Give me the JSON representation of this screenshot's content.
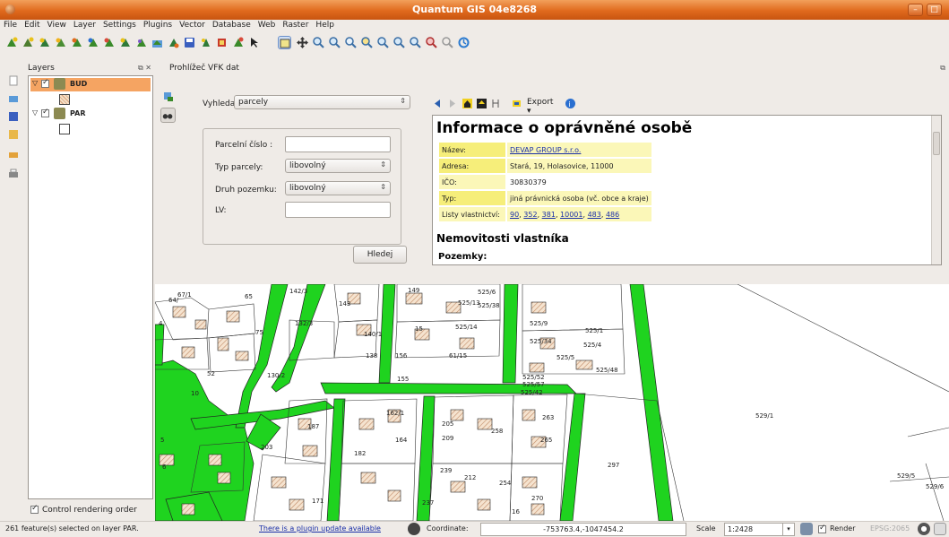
{
  "window": {
    "title": "Quantum GIS 04e8268"
  },
  "menu": [
    "File",
    "Edit",
    "View",
    "Layer",
    "Settings",
    "Plugins",
    "Vector",
    "Database",
    "Web",
    "Raster",
    "Help"
  ],
  "layers_panel": {
    "title": "Layers",
    "layers": [
      {
        "name": "BUD",
        "checked": true,
        "selected": true
      },
      {
        "name": "PAR",
        "checked": true,
        "selected": false
      }
    ],
    "control_rendering_order": "Control rendering order"
  },
  "vfk": {
    "title": "Prohlížeč VFK dat",
    "search_label": "Vyhledat:",
    "search_value": "parcely",
    "form": {
      "parcelni_cislo_label": "Parcelní číslo :",
      "typ_parcely_label": "Typ parcely:",
      "typ_parcely_value": "libovolný",
      "druh_pozemku_label": "Druh pozemku:",
      "druh_pozemku_value": "libovolný",
      "lv_label": "LV:"
    },
    "search_button": "Hledej",
    "export_label": "Export",
    "info": {
      "heading": "Informace o oprávněné osobě",
      "rows": [
        {
          "key": "Název:",
          "value": "DEVAP GROUP s.r.o.",
          "link": true
        },
        {
          "key": "Adresa:",
          "value": "Stará, 19, Holasovice, 11000",
          "link": false
        },
        {
          "key": "IČO:",
          "value": "30830379",
          "link": false
        },
        {
          "key": "Typ:",
          "value": "jiná právnická osoba (vč. obce a kraje)",
          "link": false
        }
      ],
      "listy_label": "Listy vlastnictví:",
      "listy": [
        "90",
        "352",
        "381",
        "10001",
        "483",
        "486"
      ],
      "subheading": "Nemovitosti vlastníka",
      "cutoff_text": "Pozemky:"
    }
  },
  "map": {
    "parcel_labels": [
      "67/1",
      "64/",
      "142/3",
      "149",
      "525/13",
      "525/6",
      "525/38",
      "132/3",
      "140/1",
      "15",
      "525/14",
      "525/9",
      "525/1",
      "525/34",
      "525/4",
      "525/5",
      "525/48",
      "130/2",
      "138",
      "156",
      "61/15",
      "525/52",
      "525/57",
      "525/42",
      "155",
      "529/1",
      "187",
      "162/1",
      "205",
      "263",
      "203",
      "182",
      "209",
      "258",
      "265",
      "297",
      "239",
      "212",
      "254",
      "270",
      "237",
      "171",
      "529/5",
      "529/6",
      "4",
      "65",
      "75",
      "143",
      "5",
      "6",
      "10",
      "52",
      "164",
      "16"
    ]
  },
  "status": {
    "selection": "261 feature(s) selected on layer PAR.",
    "plugin_update": "There is a plugin update available",
    "coordinate_label": "Coordinate:",
    "coordinate_value": "-753763.4,-1047454.2",
    "scale_label": "Scale",
    "scale_value": "1:2428",
    "render_label": "Render",
    "epsg": "EPSG:2065"
  },
  "colors": {
    "title_orange": "#e06a1d",
    "selection_orange": "#f5a462",
    "parcel_green": "#1fd31f",
    "info_yellow": "#f6ee7a"
  }
}
